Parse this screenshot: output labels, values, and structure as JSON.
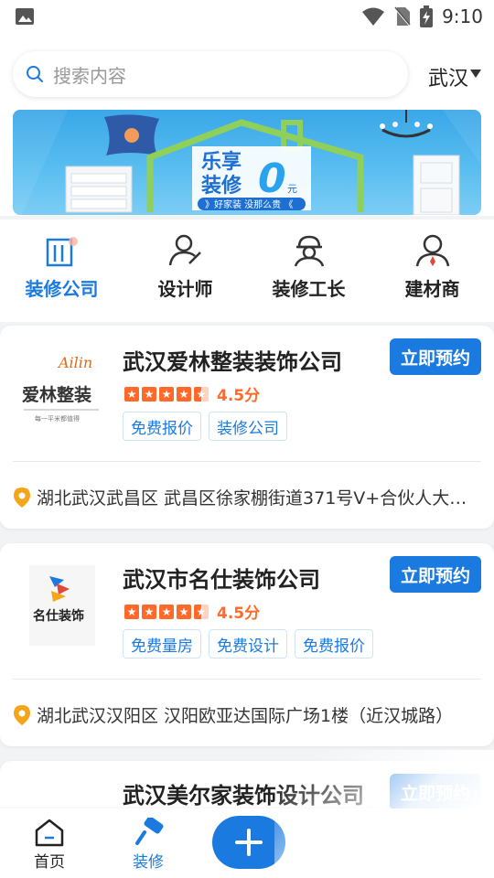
{
  "status_bar": {
    "time": "9:10"
  },
  "search": {
    "placeholder": "搜索内容"
  },
  "city": {
    "name": "武汉"
  },
  "banner": {
    "headline_1": "乐享",
    "headline_2": "装修",
    "headline_big": "0",
    "headline_unit": "元",
    "slogan": "》好家装 没那么贵 《"
  },
  "categories": [
    {
      "label": "装修公司",
      "icon": "building-icon",
      "active": true
    },
    {
      "label": "设计师",
      "icon": "designer-icon",
      "active": false
    },
    {
      "label": "装修工长",
      "icon": "foreman-icon",
      "active": false
    },
    {
      "label": "建材商",
      "icon": "supplier-icon",
      "active": false
    }
  ],
  "companies": [
    {
      "name": "武汉爱林整装装饰公司",
      "logo_text": "爱林整装",
      "logo_script": "Ailin",
      "logo_tagline": "每一平米都值得",
      "book_label": "立即预约",
      "rating": 4.5,
      "score_text": "4.5分",
      "tags": [
        "免费报价",
        "装修公司"
      ],
      "address": "湖北武汉武昌区 武昌区徐家棚街道371号V+合伙人大…"
    },
    {
      "name": "武汉市名仕装饰公司",
      "logo_text": "名仕装饰",
      "book_label": "立即预约",
      "rating": 4.5,
      "score_text": "4.5分",
      "tags": [
        "免费量房",
        "免费设计",
        "免费报价"
      ],
      "address": "湖北武汉汉阳区 汉阳欧亚达国际广场1楼（近汉城路）"
    },
    {
      "name": "武汉美尔家装饰设计公司",
      "book_label": "立即预约"
    }
  ],
  "bottom_nav": {
    "home": "首页",
    "decorate": "装修"
  },
  "colors": {
    "accent": "#1a7ae0",
    "rating": "#ff6a2b",
    "background": "#f2f3f5"
  }
}
